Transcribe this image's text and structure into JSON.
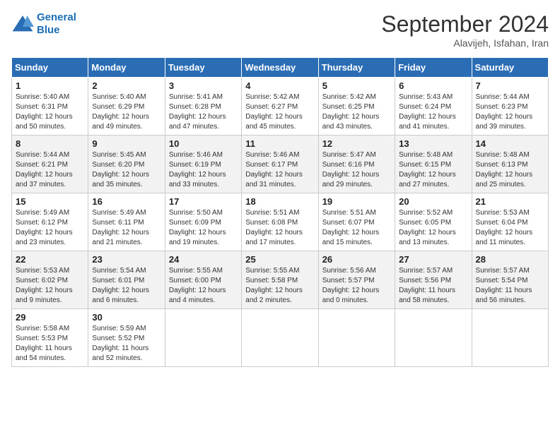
{
  "header": {
    "logo_line1": "General",
    "logo_line2": "Blue",
    "month_title": "September 2024",
    "location": "Alavijeh, Isfahan, Iran"
  },
  "weekdays": [
    "Sunday",
    "Monday",
    "Tuesday",
    "Wednesday",
    "Thursday",
    "Friday",
    "Saturday"
  ],
  "weeks": [
    [
      {
        "day": "1",
        "sunrise": "5:40 AM",
        "sunset": "6:31 PM",
        "daylight": "12 hours and 50 minutes."
      },
      {
        "day": "2",
        "sunrise": "5:40 AM",
        "sunset": "6:29 PM",
        "daylight": "12 hours and 49 minutes."
      },
      {
        "day": "3",
        "sunrise": "5:41 AM",
        "sunset": "6:28 PM",
        "daylight": "12 hours and 47 minutes."
      },
      {
        "day": "4",
        "sunrise": "5:42 AM",
        "sunset": "6:27 PM",
        "daylight": "12 hours and 45 minutes."
      },
      {
        "day": "5",
        "sunrise": "5:42 AM",
        "sunset": "6:25 PM",
        "daylight": "12 hours and 43 minutes."
      },
      {
        "day": "6",
        "sunrise": "5:43 AM",
        "sunset": "6:24 PM",
        "daylight": "12 hours and 41 minutes."
      },
      {
        "day": "7",
        "sunrise": "5:44 AM",
        "sunset": "6:23 PM",
        "daylight": "12 hours and 39 minutes."
      }
    ],
    [
      {
        "day": "8",
        "sunrise": "5:44 AM",
        "sunset": "6:21 PM",
        "daylight": "12 hours and 37 minutes."
      },
      {
        "day": "9",
        "sunrise": "5:45 AM",
        "sunset": "6:20 PM",
        "daylight": "12 hours and 35 minutes."
      },
      {
        "day": "10",
        "sunrise": "5:46 AM",
        "sunset": "6:19 PM",
        "daylight": "12 hours and 33 minutes."
      },
      {
        "day": "11",
        "sunrise": "5:46 AM",
        "sunset": "6:17 PM",
        "daylight": "12 hours and 31 minutes."
      },
      {
        "day": "12",
        "sunrise": "5:47 AM",
        "sunset": "6:16 PM",
        "daylight": "12 hours and 29 minutes."
      },
      {
        "day": "13",
        "sunrise": "5:48 AM",
        "sunset": "6:15 PM",
        "daylight": "12 hours and 27 minutes."
      },
      {
        "day": "14",
        "sunrise": "5:48 AM",
        "sunset": "6:13 PM",
        "daylight": "12 hours and 25 minutes."
      }
    ],
    [
      {
        "day": "15",
        "sunrise": "5:49 AM",
        "sunset": "6:12 PM",
        "daylight": "12 hours and 23 minutes."
      },
      {
        "day": "16",
        "sunrise": "5:49 AM",
        "sunset": "6:11 PM",
        "daylight": "12 hours and 21 minutes."
      },
      {
        "day": "17",
        "sunrise": "5:50 AM",
        "sunset": "6:09 PM",
        "daylight": "12 hours and 19 minutes."
      },
      {
        "day": "18",
        "sunrise": "5:51 AM",
        "sunset": "6:08 PM",
        "daylight": "12 hours and 17 minutes."
      },
      {
        "day": "19",
        "sunrise": "5:51 AM",
        "sunset": "6:07 PM",
        "daylight": "12 hours and 15 minutes."
      },
      {
        "day": "20",
        "sunrise": "5:52 AM",
        "sunset": "6:05 PM",
        "daylight": "12 hours and 13 minutes."
      },
      {
        "day": "21",
        "sunrise": "5:53 AM",
        "sunset": "6:04 PM",
        "daylight": "12 hours and 11 minutes."
      }
    ],
    [
      {
        "day": "22",
        "sunrise": "5:53 AM",
        "sunset": "6:02 PM",
        "daylight": "12 hours and 9 minutes."
      },
      {
        "day": "23",
        "sunrise": "5:54 AM",
        "sunset": "6:01 PM",
        "daylight": "12 hours and 6 minutes."
      },
      {
        "day": "24",
        "sunrise": "5:55 AM",
        "sunset": "6:00 PM",
        "daylight": "12 hours and 4 minutes."
      },
      {
        "day": "25",
        "sunrise": "5:55 AM",
        "sunset": "5:58 PM",
        "daylight": "12 hours and 2 minutes."
      },
      {
        "day": "26",
        "sunrise": "5:56 AM",
        "sunset": "5:57 PM",
        "daylight": "12 hours and 0 minutes."
      },
      {
        "day": "27",
        "sunrise": "5:57 AM",
        "sunset": "5:56 PM",
        "daylight": "11 hours and 58 minutes."
      },
      {
        "day": "28",
        "sunrise": "5:57 AM",
        "sunset": "5:54 PM",
        "daylight": "11 hours and 56 minutes."
      }
    ],
    [
      {
        "day": "29",
        "sunrise": "5:58 AM",
        "sunset": "5:53 PM",
        "daylight": "11 hours and 54 minutes."
      },
      {
        "day": "30",
        "sunrise": "5:59 AM",
        "sunset": "5:52 PM",
        "daylight": "11 hours and 52 minutes."
      },
      null,
      null,
      null,
      null,
      null
    ]
  ]
}
